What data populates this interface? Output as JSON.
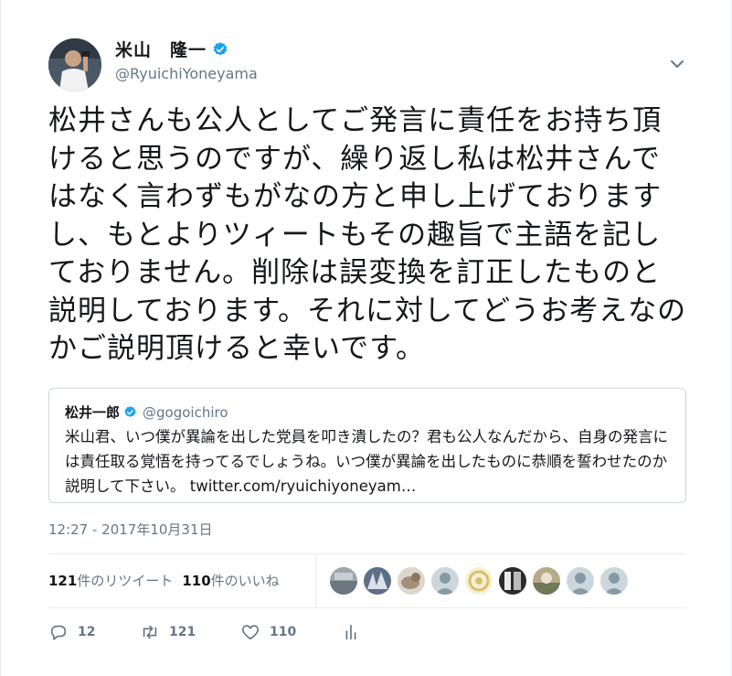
{
  "author": {
    "display_name": "米山　隆一",
    "handle": "@RyuichiYoneyama",
    "verified": true
  },
  "tweet": {
    "text": "松井さんも公人としてご発言に責任をお持ち頂けると思うのですが、繰り返し私は松井さんではなく言わずもがなの方と申し上げておりますし、もとよりツィートもその趣旨で主語を記しておりません。削除は誤変換を訂正したものと説明しております。それに対してどうお考えなのかご説明頂けると幸いです。"
  },
  "quoted": {
    "display_name": "松井一郎",
    "handle": "@gogoichiro",
    "text": "米山君、いつ僕が異論を出した党員を叩き潰したの？君も公人なんだから、自身の発言には責任取る覚悟を持ってるでしょうね。いつ僕が異論を出したものに恭順を誓わせたのか説明して下さい。 twitter.com/ryuichiyoneyam…"
  },
  "timestamp": "12:27 - 2017年10月31日",
  "stats": {
    "retweets_count": "121",
    "retweets_label": "件のリツイート",
    "likes_count": "110",
    "likes_label": "件のいいね"
  },
  "actions": {
    "reply_count": "12",
    "retweet_count": "121",
    "like_count": "110"
  },
  "colors": {
    "verified": "#1da1f2",
    "secondary_text": "#657786",
    "border": "#e6ecf0"
  },
  "icons": [
    "verified-badge-icon",
    "chevron-down-icon",
    "reply-icon",
    "retweet-icon",
    "heart-icon",
    "analytics-icon"
  ]
}
